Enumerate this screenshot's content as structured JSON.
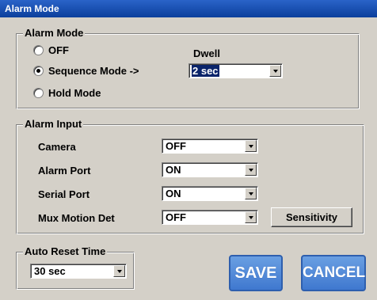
{
  "window": {
    "title": "Alarm Mode"
  },
  "alarm_mode": {
    "legend": "Alarm Mode",
    "options": [
      {
        "label": "OFF",
        "checked": false
      },
      {
        "label": "Sequence Mode ->",
        "checked": true
      },
      {
        "label": "Hold Mode",
        "checked": false
      }
    ],
    "dwell_label": "Dwell",
    "dwell_value": "2 sec"
  },
  "alarm_input": {
    "legend": "Alarm Input",
    "rows": [
      {
        "label": "Camera",
        "value": "OFF"
      },
      {
        "label": "Alarm Port",
        "value": "ON"
      },
      {
        "label": "Serial Port",
        "value": "ON"
      },
      {
        "label": "Mux Motion Det",
        "value": "OFF"
      }
    ],
    "sensitivity_label": "Sensitivity"
  },
  "auto_reset": {
    "legend": "Auto Reset Time",
    "value": "30 sec"
  },
  "buttons": {
    "save": "SAVE",
    "cancel": "CANCEL"
  }
}
